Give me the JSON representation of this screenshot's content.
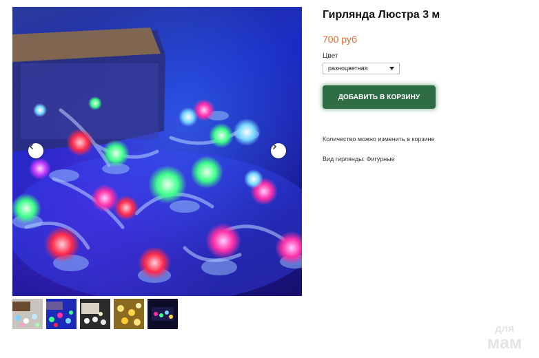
{
  "product": {
    "title": "Гирлянда Люстра 3 м",
    "price": "700 руб",
    "color_label": "Цвет",
    "color_select": {
      "selected": "разноцветная"
    },
    "add_to_cart_label": "ДОБАВИТЬ В КОРЗИНУ",
    "note": "Количество можно изменить в корзине",
    "garland_type": "Вид гирлянды: Фигурные"
  },
  "gallery": {
    "prev_icon": "chevron-left-icon",
    "next_icon": "chevron-right-icon",
    "thumbnails": [
      {
        "name": "thumbnail-1"
      },
      {
        "name": "thumbnail-2"
      },
      {
        "name": "thumbnail-3"
      },
      {
        "name": "thumbnail-4"
      },
      {
        "name": "thumbnail-5"
      }
    ]
  },
  "watermark": {
    "line1": "для",
    "line2": "мам"
  },
  "colors": {
    "price": "#e8632b",
    "button": "#2f6e45",
    "button_text": "#ffffff"
  }
}
